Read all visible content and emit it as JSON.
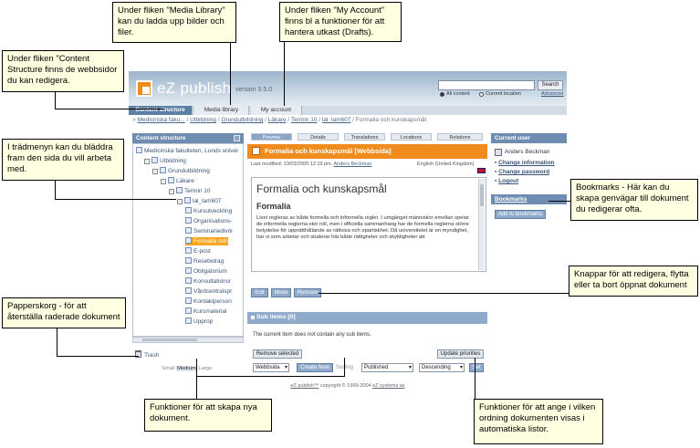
{
  "app": {
    "logo_text": "eZ publish",
    "version": "version 3.5.0",
    "search_button": "Search",
    "search_all": "All content",
    "search_current": "Current location",
    "search_advanced": "Advanced"
  },
  "tabs": [
    "Content structure",
    "Media library",
    "My account"
  ],
  "breadcrumb": {
    "prefix": "> ",
    "links": [
      "Medicinska faku...",
      "Utbildning",
      "Grundutbildning",
      "Läkare",
      "Termin 10",
      "lal_lam607"
    ],
    "current": "Formalia och kunskapsmål"
  },
  "left_panel": {
    "title": "Content structure",
    "tree": [
      {
        "label": "Medicinska fakulteten, Lunds univer",
        "level": 0,
        "toggle": ""
      },
      {
        "label": "Utbildning",
        "level": 1,
        "toggle": "-"
      },
      {
        "label": "Grundutbildning",
        "level": 2,
        "toggle": "-"
      },
      {
        "label": "Läkare",
        "level": 3,
        "toggle": "-"
      },
      {
        "label": "Termin 10",
        "level": 4,
        "toggle": "-"
      },
      {
        "label": "lal_lam607",
        "level": 5,
        "toggle": "-"
      },
      {
        "label": "Kursutveckling",
        "level": 6,
        "toggle": ""
      },
      {
        "label": "Organisations-",
        "level": 6,
        "toggle": ""
      },
      {
        "label": "Seminariedivni",
        "level": 6,
        "toggle": ""
      },
      {
        "label": "Formalia och",
        "level": 6,
        "toggle": "",
        "selected": true
      },
      {
        "label": "E-post",
        "level": 6,
        "toggle": ""
      },
      {
        "label": "Resebidrag",
        "level": 6,
        "toggle": ""
      },
      {
        "label": "Obligatorium",
        "level": 6,
        "toggle": ""
      },
      {
        "label": "Konsultationsr",
        "level": 6,
        "toggle": ""
      },
      {
        "label": "Vårdcentralspr",
        "level": 6,
        "toggle": ""
      },
      {
        "label": "Kontaktperson",
        "level": 6,
        "toggle": ""
      },
      {
        "label": "Kursmaterial",
        "level": 6,
        "toggle": ""
      },
      {
        "label": "Upprop",
        "level": 6,
        "toggle": ""
      }
    ],
    "trash": "Trash",
    "size_small": "Small",
    "size_medium": "Medium",
    "size_large": "Large"
  },
  "content": {
    "subtabs": [
      "Preview",
      "Details",
      "Translations",
      "Locations",
      "Relations"
    ],
    "header": "Formalia och kunskapsmål [Webbsida]",
    "modified_prefix": "Last modified: 13/03/2005 12:19 pm, ",
    "modified_author": "Anders Beckman",
    "language": "English (United Kingdom)",
    "doc_title": "Formalia och kunskapsmål",
    "doc_subtitle": "Formalia",
    "doc_text": "Livet regleras av både formella och informella regler. I umgänget människor emellan spelar de informella reglerna stor roll, men i officiella sammanhang har de formella reglerna större betydelse för upprätthållande av rättvisa och opartiskhet. Då universitetet är en myndighet, har vi som arbetar och studerar här både rättigheter och skyldigheter att",
    "buttons": [
      "Edit",
      "Move",
      "Remove"
    ],
    "sub_items_title": "Sub items [0]",
    "sub_items_empty": "The current item does not contain any sub items.",
    "remove_selected": "Remove selected",
    "update_priorities": "Update priorities",
    "create_type": "Webbsida",
    "create_button": "Create here",
    "sorting_label": "Sorting",
    "sort_field": "Published",
    "sort_order": "Descending",
    "set_button": "Set"
  },
  "right_panel": {
    "current_user_title": "Current user",
    "user_name": "Anders Beckman",
    "links": [
      "Change information",
      "Change password",
      "Logout"
    ],
    "bookmarks_title": "Bookmarks",
    "add_bookmark": "Add to bookmarks"
  },
  "footer": {
    "link1": "eZ publish™",
    "middle": " copyright © 1999-2004 ",
    "link2": "eZ systems as"
  },
  "annotations": {
    "media_library": "Under fliken \"Media Library\" kan du ladda upp bilder och filer.",
    "my_account": "Under fliken \"My Account\" finns bl a funktioner för att hantera utkast (Drafts).",
    "content_structure": "Under fliken \"Content Structure finns de webbsidor du kan redigera.",
    "tree_menu": "I trädmenyn kan du bläddra fram den sida du vill arbeta med.",
    "bookmarks": "Bookmarks - Här kan du skapa genvägar till dokument du redigerar ofta.",
    "buttons": "Knappar för att redigera, flytta eller ta bort öppnat dokument",
    "trash": "Papperskorg - för att återställa raderade dokument",
    "create": "Funktioner för att skapa nya dokument.",
    "sorting": "Funktioner för att ange i vilken ordning dokumenten visas i automatiska listor."
  },
  "colors": {
    "accent_orange": "#f08c1e",
    "panel_blue": "#6f8db0",
    "callout_bg": "#ffffe1"
  }
}
